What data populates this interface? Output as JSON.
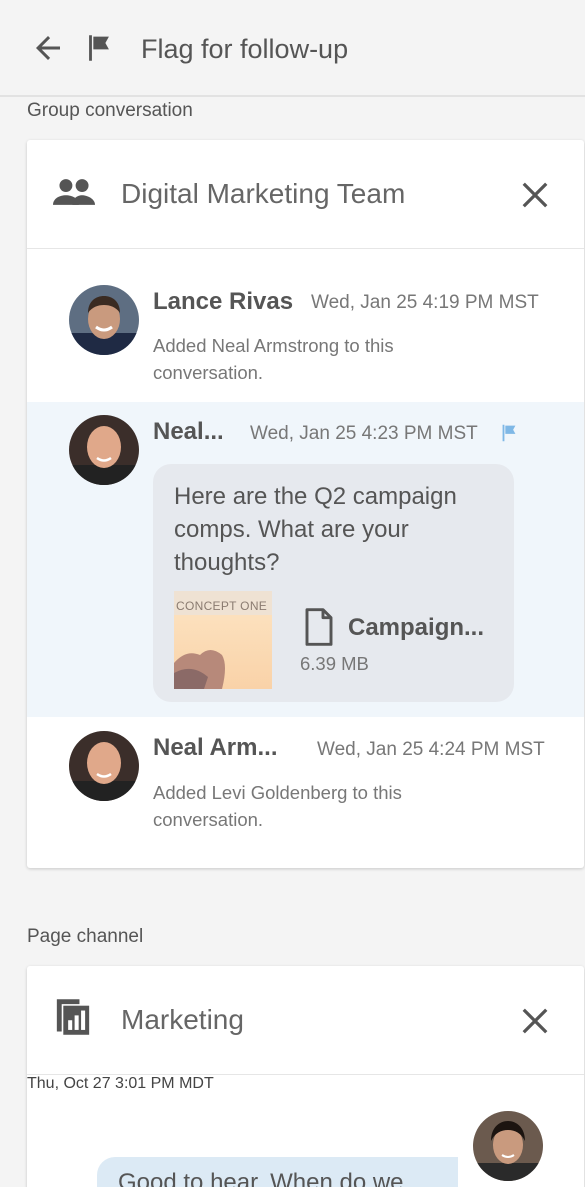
{
  "header": {
    "title": "Flag for follow-up",
    "back_icon": "arrow-left-icon",
    "flag_icon": "flag-icon"
  },
  "sections": {
    "group_label": "Group conversation",
    "page_label": "Page channel"
  },
  "group_card": {
    "title": "Digital Marketing Team",
    "icon": "people-icon",
    "messages": [
      {
        "name": "Lance Rivas",
        "time": "Wed, Jan 25 4:19 PM MST",
        "text": "Added Neal Armstrong to this conversation."
      },
      {
        "name": "Neal...",
        "time": "Wed, Jan 25 4:23 PM MST",
        "text": "Here are the Q2 campaign comps. What are your thoughts?",
        "flagged": true,
        "attachment": {
          "thumb_label": "CONCEPT ONE",
          "name": "Campaign...",
          "size": "6.39 MB"
        }
      },
      {
        "name": "Neal Arm...",
        "time": "Wed, Jan 25 4:24 PM MST",
        "text": "Added Levi Goldenberg to this conversation."
      }
    ]
  },
  "page_card": {
    "title": "Marketing",
    "icon": "page-chart-icon",
    "message": {
      "time": "Thu, Oct 27 3:01 PM MDT",
      "text": "Good to hear. When do we"
    }
  },
  "colors": {
    "flag_accent": "#7fb8e6",
    "highlight_row": "#f0f6fb",
    "bubble": "#e6e9ee"
  }
}
